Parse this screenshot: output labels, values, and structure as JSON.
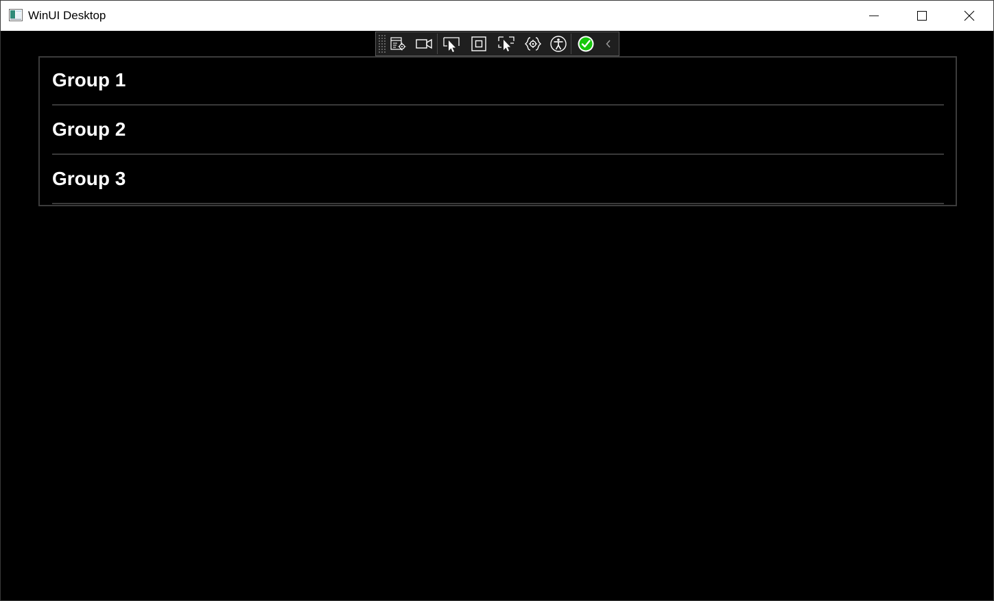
{
  "window": {
    "title": "WinUI Desktop"
  },
  "dev_toolbar": {
    "tools": [
      {
        "name": "go-to-live-visual-tree-icon"
      },
      {
        "name": "select-element-icon"
      },
      {
        "name": "display-layout-adorners-icon"
      },
      {
        "name": "track-focus-icon"
      },
      {
        "name": "hot-reload-icon"
      },
      {
        "name": "binding-failures-icon"
      },
      {
        "name": "accessibility-icon"
      },
      {
        "name": "checkmark-icon"
      }
    ],
    "collapse_glyph": "‹"
  },
  "groups": [
    {
      "label": "Group 1"
    },
    {
      "label": "Group 2"
    },
    {
      "label": "Group 3"
    }
  ],
  "colors": {
    "background": "#000000",
    "titlebar": "#ffffff",
    "text": "#ffffff",
    "check_green": "#16c60c"
  }
}
